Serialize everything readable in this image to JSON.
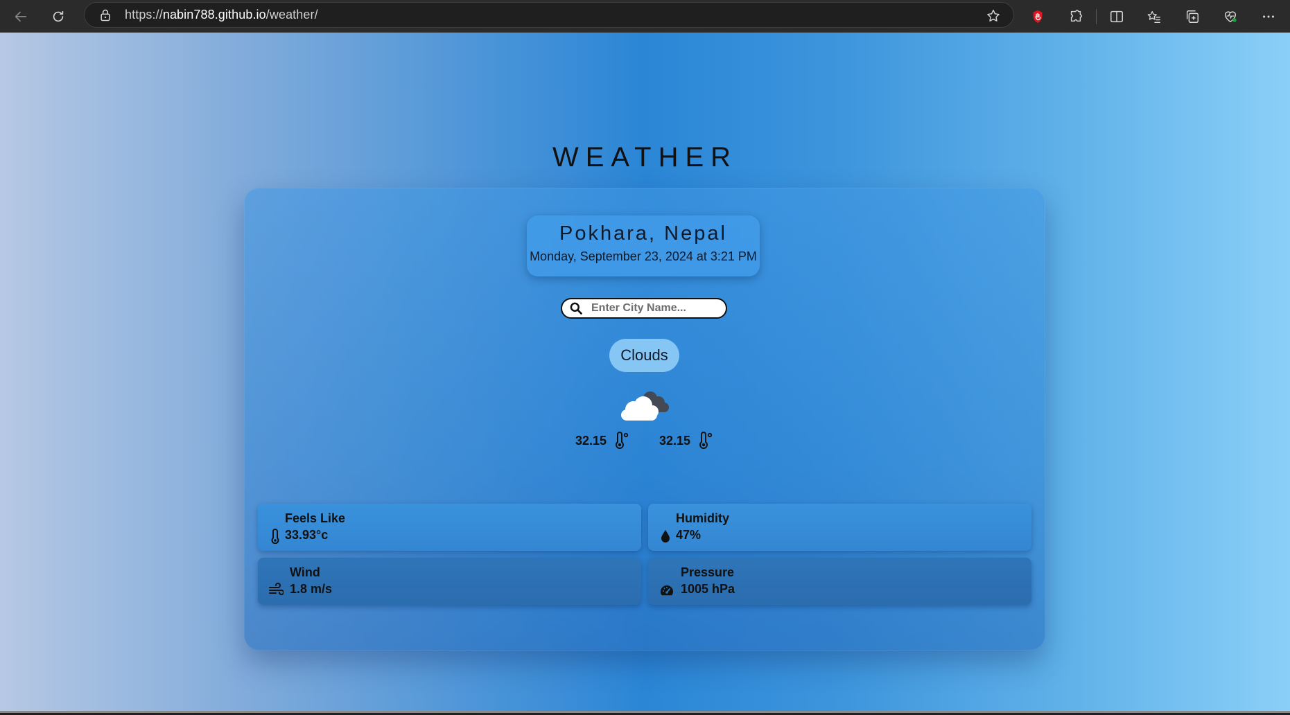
{
  "browser": {
    "url_scheme": "https://",
    "url_host": "nabin788.github.io",
    "url_path": "/weather/"
  },
  "page": {
    "title": "WEATHER"
  },
  "location": {
    "city": "Pokhara, Nepal",
    "datetime": "Monday, September 23, 2024 at 3:21 PM"
  },
  "search": {
    "placeholder": "Enter City Name..."
  },
  "condition": {
    "label": "Clouds",
    "icon": "cloud-icon"
  },
  "temps": {
    "min": "32.15",
    "max": "32.15",
    "unit_icon": "thermometer-icon"
  },
  "stats": {
    "feels_like": {
      "label": "Feels Like",
      "value": "33.93°c",
      "icon": "thermometer-icon"
    },
    "humidity": {
      "label": "Humidity",
      "value": "47%",
      "icon": "droplet-icon"
    },
    "wind": {
      "label": "Wind",
      "value": "1.8 m/s",
      "icon": "wind-icon"
    },
    "pressure": {
      "label": "Pressure",
      "value": "1005 hPa",
      "icon": "gauge-icon"
    }
  },
  "colors": {
    "card_bg": "#3a92dc",
    "pill_bg": "#86c6f4",
    "text_dark": "#111111"
  }
}
